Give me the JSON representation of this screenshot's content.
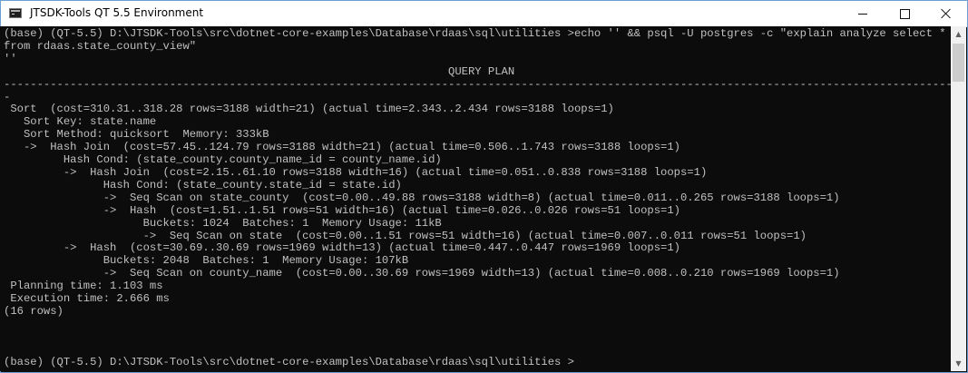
{
  "window": {
    "title": "JTSDK-Tools QT 5.5 Environment",
    "icon": "console-icon",
    "controls": {
      "minimize_icon": "minimize-icon",
      "maximize_icon": "maximize-icon",
      "close_icon": "close-icon"
    }
  },
  "console": {
    "lines": [
      "(base) (QT-5.5) D:\\JTSDK-Tools\\src\\dotnet-core-examples\\Database\\rdaas\\sql\\utilities >echo '' && psql -U postgres -c \"explain analyze select * from rdaas.state_county_view\"",
      "''",
      "                                                                   QUERY PLAN",
      "------------------------------------------------------------------------------------------------------------------------------------------------",
      " Sort  (cost=310.31..318.28 rows=3188 width=21) (actual time=2.343..2.434 rows=3188 loops=1)",
      "   Sort Key: state.name",
      "   Sort Method: quicksort  Memory: 333kB",
      "   ->  Hash Join  (cost=57.45..124.79 rows=3188 width=21) (actual time=0.506..1.743 rows=3188 loops=1)",
      "         Hash Cond: (state_county.county_name_id = county_name.id)",
      "         ->  Hash Join  (cost=2.15..61.10 rows=3188 width=16) (actual time=0.051..0.838 rows=3188 loops=1)",
      "               Hash Cond: (state_county.state_id = state.id)",
      "               ->  Seq Scan on state_county  (cost=0.00..49.88 rows=3188 width=8) (actual time=0.011..0.265 rows=3188 loops=1)",
      "               ->  Hash  (cost=1.51..1.51 rows=51 width=16) (actual time=0.026..0.026 rows=51 loops=1)",
      "                     Buckets: 1024  Batches: 1  Memory Usage: 11kB",
      "                     ->  Seq Scan on state  (cost=0.00..1.51 rows=51 width=16) (actual time=0.007..0.011 rows=51 loops=1)",
      "         ->  Hash  (cost=30.69..30.69 rows=1969 width=13) (actual time=0.447..0.447 rows=1969 loops=1)",
      "               Buckets: 2048  Batches: 1  Memory Usage: 107kB",
      "               ->  Seq Scan on county_name  (cost=0.00..30.69 rows=1969 width=13) (actual time=0.008..0.210 rows=1969 loops=1)",
      " Planning time: 1.103 ms",
      " Execution time: 2.666 ms",
      "(16 rows)",
      "",
      "",
      "",
      "(base) (QT-5.5) D:\\JTSDK-Tools\\src\\dotnet-core-examples\\Database\\rdaas\\sql\\utilities >"
    ]
  },
  "colors": {
    "console_bg": "#0c0c0c",
    "console_fg": "#c0c0c0",
    "titlebar_bg": "#ffffff"
  }
}
